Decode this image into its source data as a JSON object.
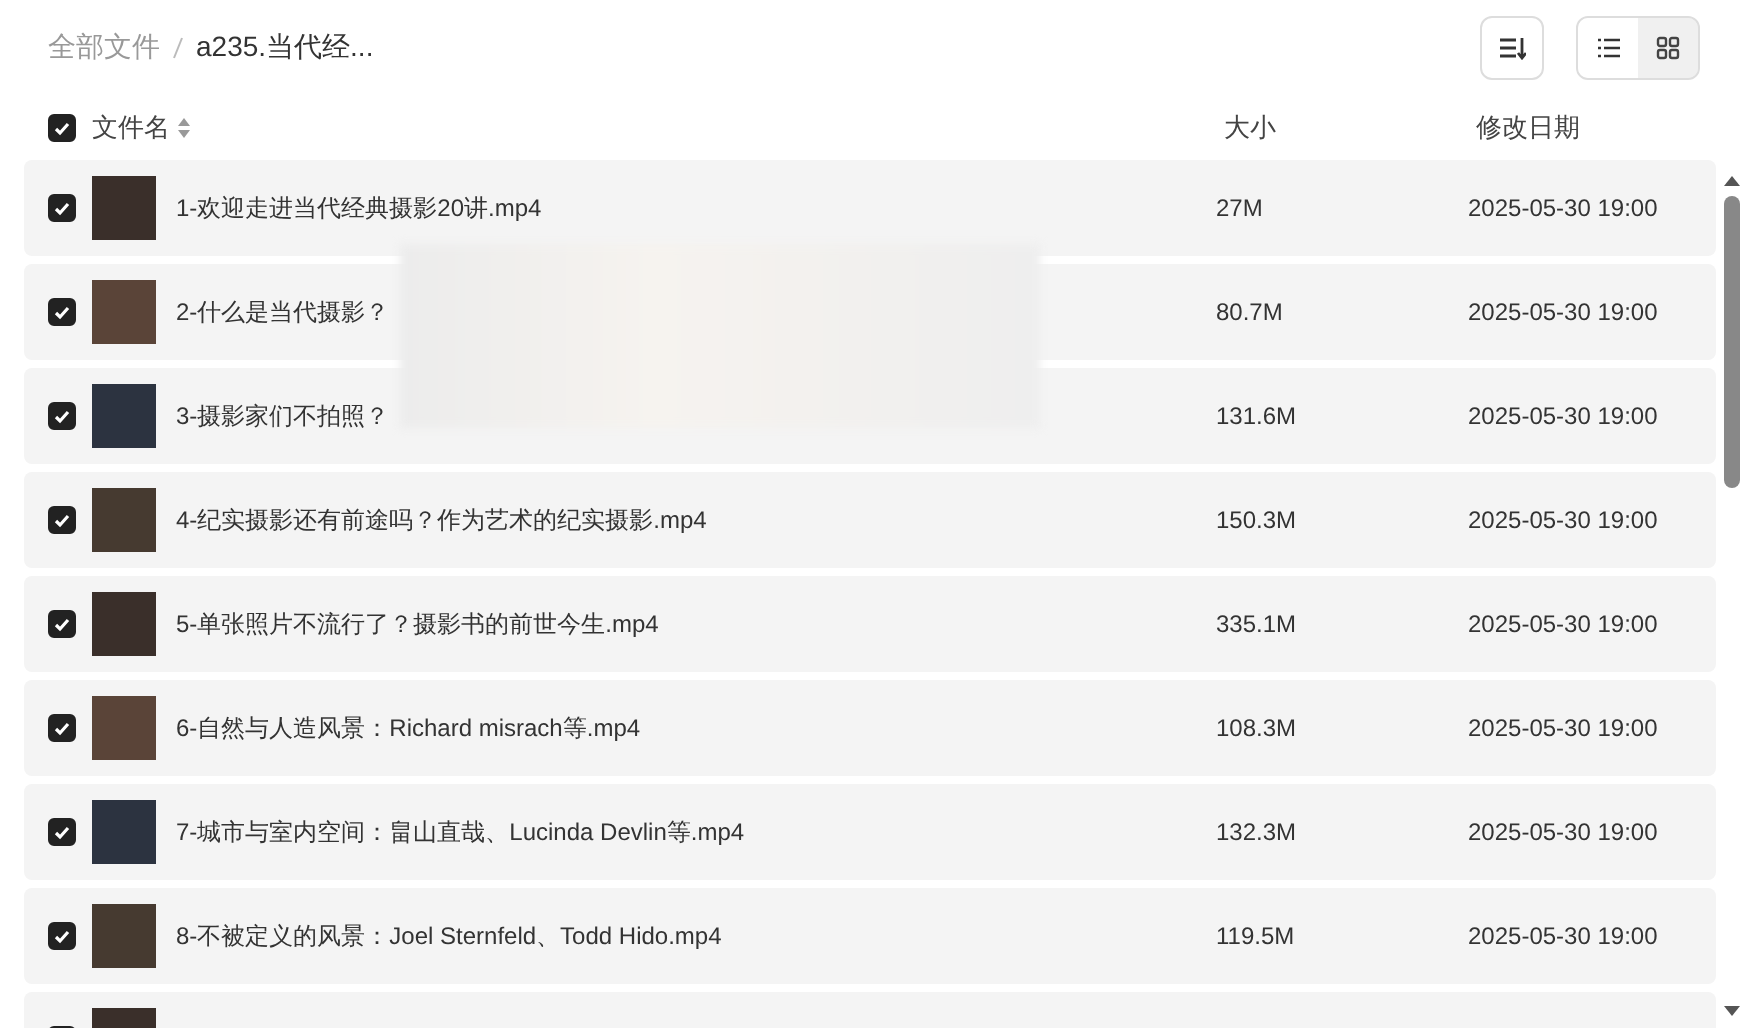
{
  "breadcrumb": [
    {
      "label": "全部文件",
      "current": false
    },
    {
      "label": "a235.当代经...",
      "current": true
    }
  ],
  "view_toggle": [
    {
      "kind": "list",
      "selected": true
    },
    {
      "kind": "grid",
      "selected": false
    }
  ],
  "table": {
    "select_all": {
      "checked": true
    },
    "columns": [
      {
        "label": "文件名",
        "sortable": true
      },
      {
        "label": "大小",
        "sortable": false
      },
      {
        "label": "修改日期",
        "sortable": false
      }
    ],
    "rows": [
      {
        "checked": true,
        "name": "1-欢迎走进当代经典摄影20讲.mp4",
        "size": "27M",
        "modified": "2025-05-30 19:00"
      },
      {
        "checked": true,
        "name": "2-什么是当代摄影？",
        "size": "80.7M",
        "modified": "2025-05-30 19:00"
      },
      {
        "checked": true,
        "name": "3-摄影家们不拍照？",
        "size": "131.6M",
        "modified": "2025-05-30 19:00"
      },
      {
        "checked": true,
        "name": "4-纪实摄影还有前途吗？作为艺术的纪实摄影.mp4",
        "size": "150.3M",
        "modified": "2025-05-30 19:00"
      },
      {
        "checked": true,
        "name": "5-单张照片不流行了？摄影书的前世今生.mp4",
        "size": "335.1M",
        "modified": "2025-05-30 19:00"
      },
      {
        "checked": true,
        "name": "6-自然与人造风景：Richard misrach等.mp4",
        "size": "108.3M",
        "modified": "2025-05-30 19:00"
      },
      {
        "checked": true,
        "name": "7-城市与室内空间：畠山直哉、Lucinda Devlin等.mp4",
        "size": "132.3M",
        "modified": "2025-05-30 19:00"
      },
      {
        "checked": true,
        "name": "8-不被定义的风景：Joel Sternfeld、Todd Hido.mp4",
        "size": "119.5M",
        "modified": "2025-05-30 19:00"
      },
      {
        "checked": true
      }
    ]
  }
}
